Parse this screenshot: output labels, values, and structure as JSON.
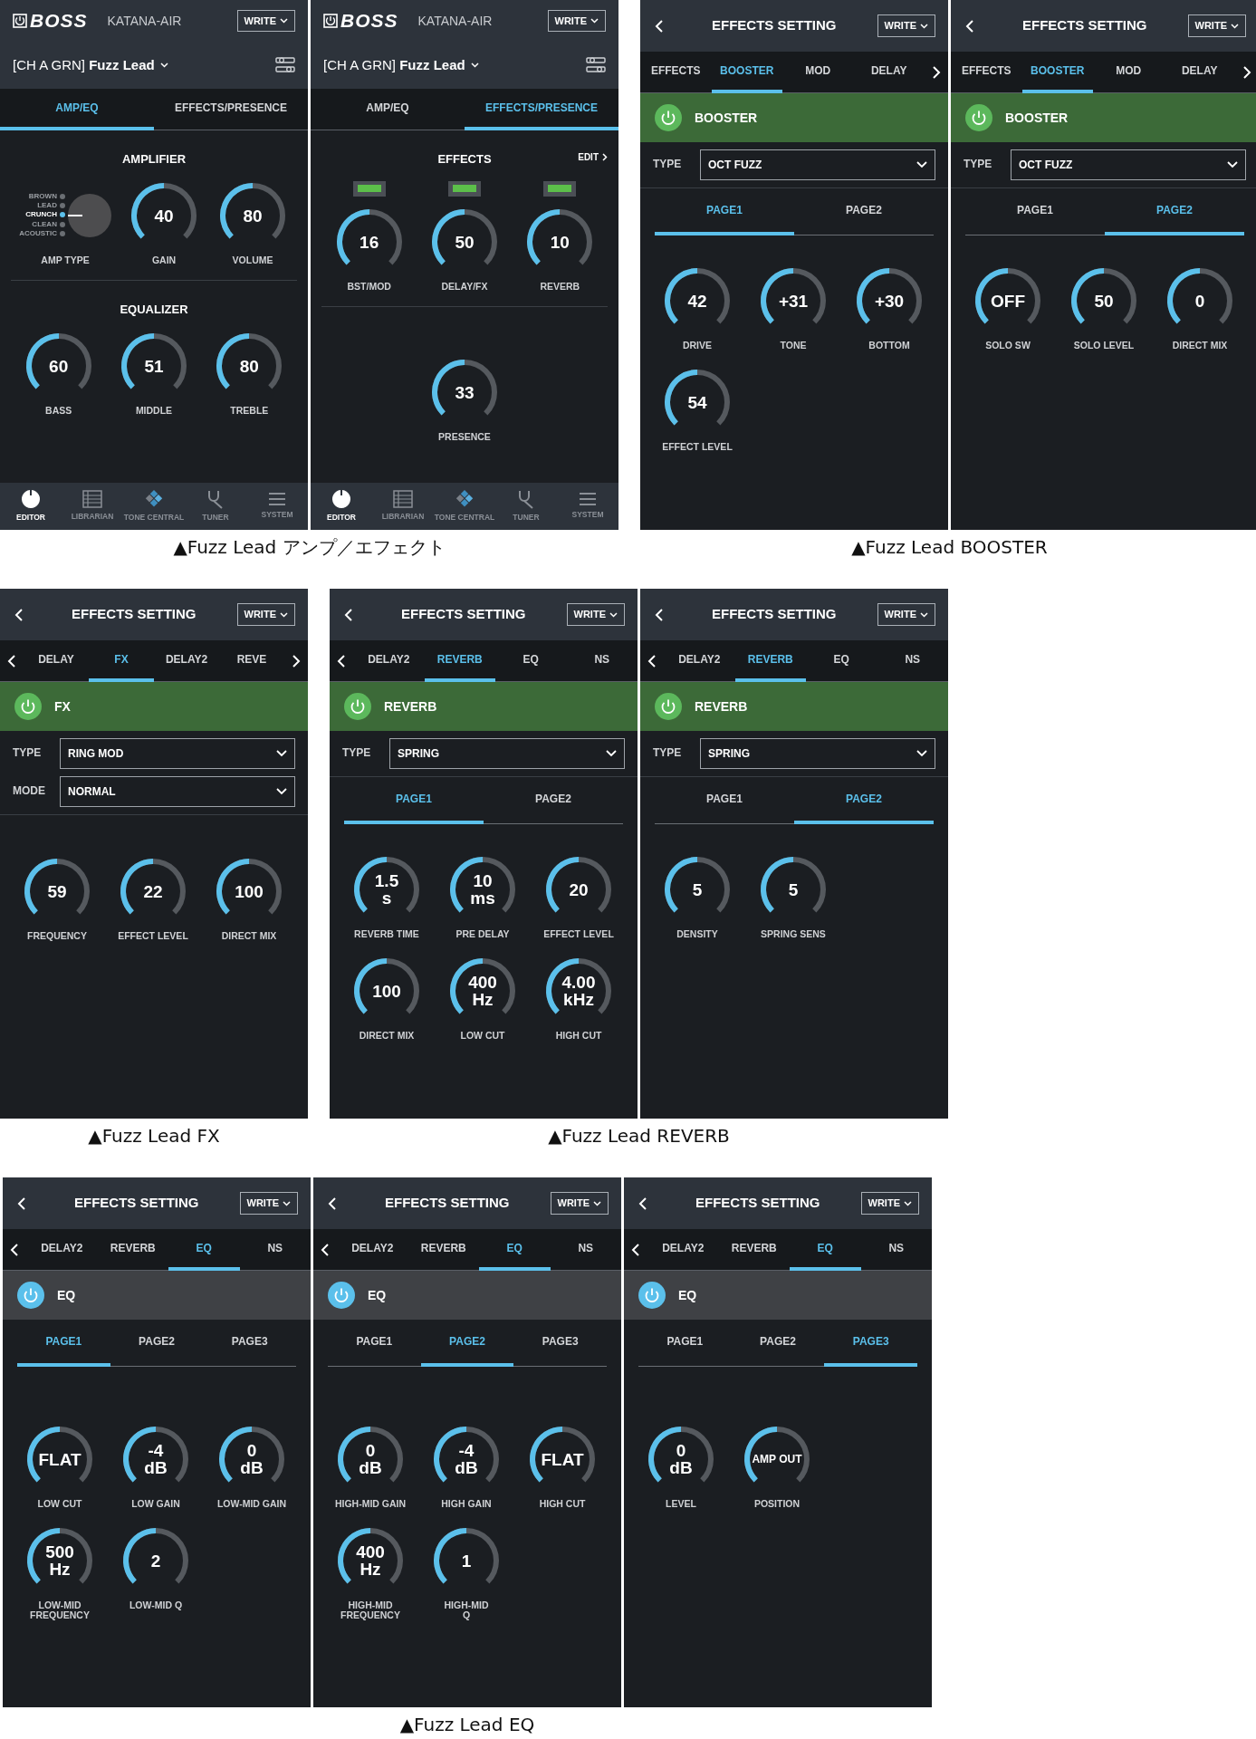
{
  "rows": [
    {
      "groups": [
        {
          "screens": [
            {
              "kind": "editor",
              "logo": "BOSS",
              "model": "KATANA-AIR",
              "write": "WRITE",
              "patch": "[CH A GRN] **Fuzz Lead**",
              "tabs": [
                {
                  "label": "AMP/EQ",
                  "selected": true
                },
                {
                  "label": "EFFECTS/PRESENCE",
                  "selected": false
                }
              ],
              "sections": [
                {
                  "title": "AMPLIFIER",
                  "items": [
                    {
                      "kind": "selector",
                      "label": "AMP TYPE",
                      "options": [
                        {
                          "label": "BROWN",
                          "selected": false
                        },
                        {
                          "label": "LEAD",
                          "selected": false
                        },
                        {
                          "label": "CRUNCH",
                          "selected": true
                        },
                        {
                          "label": "CLEAN",
                          "selected": false
                        },
                        {
                          "label": "ACOUSTIC",
                          "selected": false
                        }
                      ]
                    },
                    {
                      "kind": "knob",
                      "value": "40",
                      "label": "GAIN"
                    },
                    {
                      "kind": "knob",
                      "value": "80",
                      "label": "VOLUME"
                    }
                  ]
                },
                {
                  "title": "EQUALIZER",
                  "items": [
                    {
                      "kind": "knob",
                      "value": "60",
                      "label": "BASS"
                    },
                    {
                      "kind": "knob",
                      "value": "51",
                      "label": "MIDDLE"
                    },
                    {
                      "kind": "knob",
                      "value": "80",
                      "label": "TREBLE"
                    }
                  ]
                }
              ],
              "nav": [
                {
                  "label": "EDITOR",
                  "selected": true
                },
                {
                  "label": "LIBRARIAN",
                  "selected": false
                },
                {
                  "label": "TONE CENTRAL",
                  "selected": false
                },
                {
                  "label": "TUNER",
                  "selected": false
                },
                {
                  "label": "SYSTEM",
                  "selected": false
                }
              ]
            },
            {
              "kind": "editor",
              "logo": "BOSS",
              "model": "KATANA-AIR",
              "write": "WRITE",
              "patch": "[CH A GRN] **Fuzz Lead**",
              "tabs": [
                {
                  "label": "AMP/EQ",
                  "selected": false
                },
                {
                  "label": "EFFECTS/PRESENCE",
                  "selected": true
                }
              ],
              "sections": [
                {
                  "title": "EFFECTS",
                  "link": "EDIT",
                  "items": [
                    {
                      "kind": "knob",
                      "value": "16",
                      "label": "BST/MOD",
                      "led_on": true
                    },
                    {
                      "kind": "knob",
                      "value": "50",
                      "label": "DELAY/FX",
                      "led_on": true
                    },
                    {
                      "kind": "knob",
                      "value": "10",
                      "label": "REVERB",
                      "led_on": true
                    }
                  ]
                },
                {
                  "items": [
                    {
                      "kind": "knob",
                      "value": "33",
                      "label": "PRESENCE"
                    }
                  ]
                }
              ],
              "nav": [
                {
                  "label": "EDITOR",
                  "selected": true
                },
                {
                  "label": "LIBRARIAN",
                  "selected": false
                },
                {
                  "label": "TONE CENTRAL",
                  "selected": false
                },
                {
                  "label": "TUNER",
                  "selected": false
                },
                {
                  "label": "SYSTEM",
                  "selected": false
                }
              ]
            }
          ],
          "caption": "▲Fuzz Lead アンプ／エフェクト"
        },
        {
          "screens": [
            {
              "kind": "effects",
              "title": "EFFECTS SETTING",
              "write": "WRITE",
              "tabs_prev": false,
              "tabs_next": true,
              "tabs": [
                {
                  "label": "EFFECTS",
                  "selected": false
                },
                {
                  "label": "BOOSTER",
                  "selected": true
                },
                {
                  "label": "MOD",
                  "selected": false
                },
                {
                  "label": "DELAY",
                  "selected": false
                }
              ],
              "effect": {
                "name": "BOOSTER",
                "on": true
              },
              "selects": [
                {
                  "label": "TYPE",
                  "value": "OCT FUZZ"
                }
              ],
              "pages": [
                {
                  "label": "PAGE1",
                  "selected": true
                },
                {
                  "label": "PAGE2",
                  "selected": false
                }
              ],
              "knob_rows": [
                [
                  {
                    "value": "42",
                    "label": "DRIVE"
                  },
                  {
                    "value": "+31",
                    "label": "TONE"
                  },
                  {
                    "value": "+30",
                    "label": "BOTTOM"
                  }
                ],
                [
                  {
                    "value": "54",
                    "label": "EFFECT LEVEL"
                  }
                ]
              ]
            },
            {
              "kind": "effects",
              "title": "EFFECTS SETTING",
              "write": "WRITE",
              "tabs_prev": false,
              "tabs_next": true,
              "tabs": [
                {
                  "label": "EFFECTS",
                  "selected": false
                },
                {
                  "label": "BOOSTER",
                  "selected": true
                },
                {
                  "label": "MOD",
                  "selected": false
                },
                {
                  "label": "DELAY",
                  "selected": false
                }
              ],
              "effect": {
                "name": "BOOSTER",
                "on": true
              },
              "selects": [
                {
                  "label": "TYPE",
                  "value": "OCT FUZZ"
                }
              ],
              "pages": [
                {
                  "label": "PAGE1",
                  "selected": false
                },
                {
                  "label": "PAGE2",
                  "selected": true
                }
              ],
              "knob_rows": [
                [
                  {
                    "value": "OFF",
                    "label": "SOLO SW"
                  },
                  {
                    "value": "50",
                    "label": "SOLO LEVEL"
                  },
                  {
                    "value": "0",
                    "label": "DIRECT MIX"
                  }
                ]
              ]
            }
          ],
          "caption": "▲Fuzz Lead BOOSTER"
        }
      ]
    },
    {
      "groups": [
        {
          "screens": [
            {
              "kind": "effects",
              "title": "EFFECTS SETTING",
              "write": "WRITE",
              "tabs_prev": true,
              "tabs_next": true,
              "tabs": [
                {
                  "label": "DELAY",
                  "selected": false
                },
                {
                  "label": "FX",
                  "selected": true
                },
                {
                  "label": "DELAY2",
                  "selected": false
                },
                {
                  "label": "REVE",
                  "selected": false
                }
              ],
              "effect": {
                "name": "FX",
                "on": true
              },
              "selects": [
                {
                  "label": "TYPE",
                  "value": "RING MOD"
                },
                {
                  "label": "MODE",
                  "value": "NORMAL"
                }
              ],
              "knob_rows": [
                [
                  {
                    "value": "59",
                    "label": "FREQUENCY"
                  },
                  {
                    "value": "22",
                    "label": "EFFECT LEVEL"
                  },
                  {
                    "value": "100",
                    "label": "DIRECT MIX"
                  }
                ]
              ]
            }
          ],
          "caption": "▲Fuzz Lead FX"
        },
        {
          "screens": [
            {
              "kind": "effects",
              "title": "EFFECTS SETTING",
              "write": "WRITE",
              "tabs_prev": true,
              "tabs_next": false,
              "tabs": [
                {
                  "label": "DELAY2",
                  "selected": false
                },
                {
                  "label": "REVERB",
                  "selected": true
                },
                {
                  "label": "EQ",
                  "selected": false
                },
                {
                  "label": "NS",
                  "selected": false
                }
              ],
              "effect": {
                "name": "REVERB",
                "on": true
              },
              "selects": [
                {
                  "label": "TYPE",
                  "value": "SPRING"
                }
              ],
              "pages": [
                {
                  "label": "PAGE1",
                  "selected": true
                },
                {
                  "label": "PAGE2",
                  "selected": false
                }
              ],
              "knob_rows": [
                [
                  {
                    "value": "1.5\ns",
                    "label": "REVERB TIME"
                  },
                  {
                    "value": "10\nms",
                    "label": "PRE DELAY"
                  },
                  {
                    "value": "20",
                    "label": "EFFECT LEVEL"
                  }
                ],
                [
                  {
                    "value": "100",
                    "label": "DIRECT MIX"
                  },
                  {
                    "value": "400\nHz",
                    "label": "LOW CUT"
                  },
                  {
                    "value": "4.00\nkHz",
                    "label": "HIGH CUT"
                  }
                ]
              ]
            },
            {
              "kind": "effects",
              "title": "EFFECTS SETTING",
              "write": "WRITE",
              "tabs_prev": true,
              "tabs_next": false,
              "tabs": [
                {
                  "label": "DELAY2",
                  "selected": false
                },
                {
                  "label": "REVERB",
                  "selected": true
                },
                {
                  "label": "EQ",
                  "selected": false
                },
                {
                  "label": "NS",
                  "selected": false
                }
              ],
              "effect": {
                "name": "REVERB",
                "on": true
              },
              "selects": [
                {
                  "label": "TYPE",
                  "value": "SPRING"
                }
              ],
              "pages": [
                {
                  "label": "PAGE1",
                  "selected": false
                },
                {
                  "label": "PAGE2",
                  "selected": true
                }
              ],
              "knob_rows": [
                [
                  {
                    "value": "5",
                    "label": "DENSITY"
                  },
                  {
                    "value": "5",
                    "label": "SPRING SENS"
                  }
                ]
              ]
            }
          ],
          "caption": "▲Fuzz Lead REVERB"
        }
      ]
    },
    {
      "groups": [
        {
          "screens": [
            {
              "kind": "effects",
              "title": "EFFECTS SETTING",
              "write": "WRITE",
              "tabs_prev": true,
              "tabs_next": false,
              "tabs": [
                {
                  "label": "DELAY2",
                  "selected": false
                },
                {
                  "label": "REVERB",
                  "selected": false
                },
                {
                  "label": "EQ",
                  "selected": true
                },
                {
                  "label": "NS",
                  "selected": false
                }
              ],
              "effect": {
                "name": "EQ",
                "on": false
              },
              "pages": [
                {
                  "label": "PAGE1",
                  "selected": true
                },
                {
                  "label": "PAGE2",
                  "selected": false
                },
                {
                  "label": "PAGE3",
                  "selected": false
                }
              ],
              "knob_rows": [
                [
                  {
                    "value": "FLAT",
                    "label": "LOW CUT"
                  },
                  {
                    "value": "-4\ndB",
                    "label": "LOW GAIN"
                  },
                  {
                    "value": "0\ndB",
                    "label": "LOW-MID GAIN"
                  }
                ],
                [
                  {
                    "value": "500\nHz",
                    "label": "LOW-MID\nFREQUENCY"
                  },
                  {
                    "value": "2",
                    "label": "LOW-MID Q"
                  }
                ]
              ]
            },
            {
              "kind": "effects",
              "title": "EFFECTS SETTING",
              "write": "WRITE",
              "tabs_prev": true,
              "tabs_next": false,
              "tabs": [
                {
                  "label": "DELAY2",
                  "selected": false
                },
                {
                  "label": "REVERB",
                  "selected": false
                },
                {
                  "label": "EQ",
                  "selected": true
                },
                {
                  "label": "NS",
                  "selected": false
                }
              ],
              "effect": {
                "name": "EQ",
                "on": false
              },
              "pages": [
                {
                  "label": "PAGE1",
                  "selected": false
                },
                {
                  "label": "PAGE2",
                  "selected": true
                },
                {
                  "label": "PAGE3",
                  "selected": false
                }
              ],
              "knob_rows": [
                [
                  {
                    "value": "0\ndB",
                    "label": "HIGH-MID GAIN"
                  },
                  {
                    "value": "-4\ndB",
                    "label": "HIGH GAIN"
                  },
                  {
                    "value": "FLAT",
                    "label": "HIGH CUT"
                  }
                ],
                [
                  {
                    "value": "400\nHz",
                    "label": "HIGH-MID\nFREQUENCY"
                  },
                  {
                    "value": "1",
                    "label": "HIGH-MID\nQ"
                  }
                ]
              ]
            },
            {
              "kind": "effects",
              "title": "EFFECTS SETTING",
              "write": "WRITE",
              "tabs_prev": true,
              "tabs_next": false,
              "tabs": [
                {
                  "label": "DELAY2",
                  "selected": false
                },
                {
                  "label": "REVERB",
                  "selected": false
                },
                {
                  "label": "EQ",
                  "selected": true
                },
                {
                  "label": "NS",
                  "selected": false
                }
              ],
              "effect": {
                "name": "EQ",
                "on": false
              },
              "pages": [
                {
                  "label": "PAGE1",
                  "selected": false
                },
                {
                  "label": "PAGE2",
                  "selected": false
                },
                {
                  "label": "PAGE3",
                  "selected": true
                }
              ],
              "knob_rows": [
                [
                  {
                    "value": "0\ndB",
                    "label": "LEVEL"
                  },
                  {
                    "value": "AMP OUT",
                    "label": "POSITION"
                  }
                ]
              ]
            }
          ],
          "caption": "▲Fuzz Lead EQ"
        }
      ]
    }
  ]
}
